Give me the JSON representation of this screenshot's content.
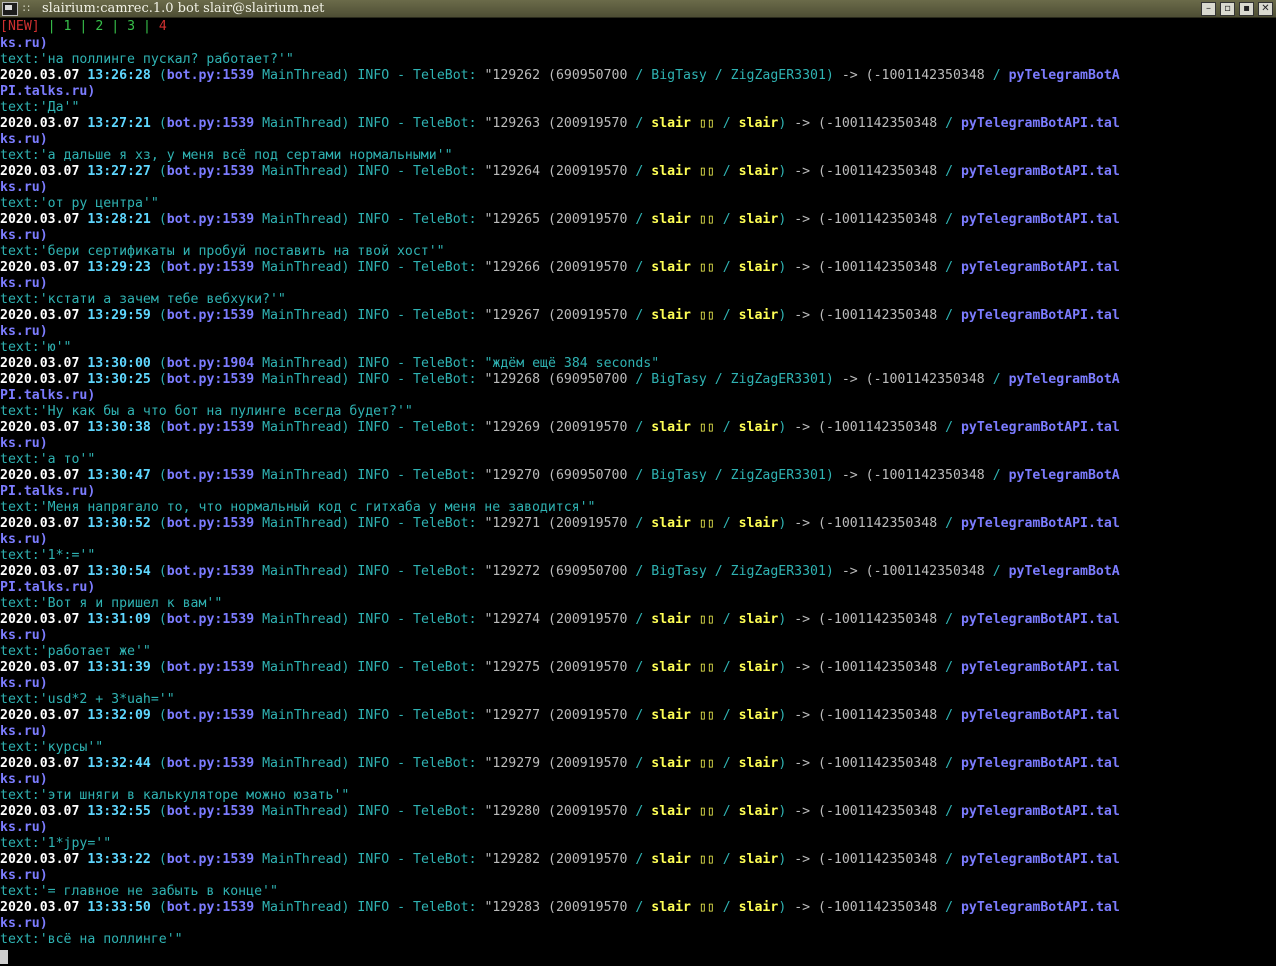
{
  "window": {
    "title": "slairium:camrec.1.0 bot slair@slairium.net",
    "controls": [
      "–",
      "▫",
      "▪",
      "✕"
    ]
  },
  "tabbar": {
    "new_label": "[NEW]",
    "tabs": [
      "1",
      "2",
      "3",
      "4"
    ],
    "active_tab": "4"
  },
  "log": {
    "lines": [
      {
        "kind": "wrap",
        "text": "ks.ru)"
      },
      {
        "kind": "text",
        "text": "text:'на поллинге пускал? работает?'\""
      },
      {
        "kind": "entry",
        "date": "2020.03.07",
        "time": "13:26:28",
        "file": "bot.py:1539",
        "thread": "MainThread",
        "level": "INFO",
        "logger": "TeleBot:",
        "id": "\"129262",
        "uid": "(690950700",
        "name1": "BigTasy",
        "name2": "ZigZagER3301)",
        "chat_id": "-> (-1001142350348",
        "chat": "pyTelegramBotA",
        "style": "plain"
      },
      {
        "kind": "wrap",
        "text": "PI.talks.ru)"
      },
      {
        "kind": "text",
        "text": "text:'Да'\""
      },
      {
        "kind": "entry",
        "date": "2020.03.07",
        "time": "13:27:21",
        "file": "bot.py:1539",
        "thread": "MainThread",
        "level": "INFO",
        "logger": "TeleBot:",
        "id": "\"129263",
        "uid": "(200919570",
        "name1": "slair ▯▯",
        "name2": "slair)",
        "chat_id": "-> (-1001142350348",
        "chat": "pyTelegramBotAPI.tal",
        "style": "bold"
      },
      {
        "kind": "wrap",
        "text": "ks.ru)"
      },
      {
        "kind": "text",
        "text": "text:'а дальше я хз, у меня всё под сертами нормальными'\""
      },
      {
        "kind": "entry",
        "date": "2020.03.07",
        "time": "13:27:27",
        "file": "bot.py:1539",
        "thread": "MainThread",
        "level": "INFO",
        "logger": "TeleBot:",
        "id": "\"129264",
        "uid": "(200919570",
        "name1": "slair ▯▯",
        "name2": "slair)",
        "chat_id": "-> (-1001142350348",
        "chat": "pyTelegramBotAPI.tal",
        "style": "bold"
      },
      {
        "kind": "wrap",
        "text": "ks.ru)"
      },
      {
        "kind": "text",
        "text": "text:'от ру центра'\""
      },
      {
        "kind": "entry",
        "date": "2020.03.07",
        "time": "13:28:21",
        "file": "bot.py:1539",
        "thread": "MainThread",
        "level": "INFO",
        "logger": "TeleBot:",
        "id": "\"129265",
        "uid": "(200919570",
        "name1": "slair ▯▯",
        "name2": "slair)",
        "chat_id": "-> (-1001142350348",
        "chat": "pyTelegramBotAPI.tal",
        "style": "bold"
      },
      {
        "kind": "wrap",
        "text": "ks.ru)"
      },
      {
        "kind": "text",
        "text": "text:'бери сертификаты и пробуй поставить на твой хост'\""
      },
      {
        "kind": "entry",
        "date": "2020.03.07",
        "time": "13:29:23",
        "file": "bot.py:1539",
        "thread": "MainThread",
        "level": "INFO",
        "logger": "TeleBot:",
        "id": "\"129266",
        "uid": "(200919570",
        "name1": "slair ▯▯",
        "name2": "slair)",
        "chat_id": "-> (-1001142350348",
        "chat": "pyTelegramBotAPI.tal",
        "style": "bold"
      },
      {
        "kind": "wrap",
        "text": "ks.ru)"
      },
      {
        "kind": "text",
        "text": "text:'кстати а зачем тебе вебхуки?'\""
      },
      {
        "kind": "entry",
        "date": "2020.03.07",
        "time": "13:29:59",
        "file": "bot.py:1539",
        "thread": "MainThread",
        "level": "INFO",
        "logger": "TeleBot:",
        "id": "\"129267",
        "uid": "(200919570",
        "name1": "slair ▯▯",
        "name2": "slair)",
        "chat_id": "-> (-1001142350348",
        "chat": "pyTelegramBotAPI.tal",
        "style": "bold"
      },
      {
        "kind": "wrap",
        "text": "ks.ru)"
      },
      {
        "kind": "text",
        "text": "text:'ю'\""
      },
      {
        "kind": "wait",
        "date": "2020.03.07",
        "time": "13:30:00",
        "file": "bot.py:1904",
        "thread": "MainThread",
        "level": "INFO",
        "logger": "TeleBot:",
        "message": "\"ждём ещё 384 seconds\""
      },
      {
        "kind": "entry",
        "date": "2020.03.07",
        "time": "13:30:25",
        "file": "bot.py:1539",
        "thread": "MainThread",
        "level": "INFO",
        "logger": "TeleBot:",
        "id": "\"129268",
        "uid": "(690950700",
        "name1": "BigTasy",
        "name2": "ZigZagER3301)",
        "chat_id": "-> (-1001142350348",
        "chat": "pyTelegramBotA",
        "style": "plain"
      },
      {
        "kind": "wrap",
        "text": "PI.talks.ru)"
      },
      {
        "kind": "text",
        "text": "text:'Ну как бы а что бот на пулинге всегда будет?'\""
      },
      {
        "kind": "entry",
        "date": "2020.03.07",
        "time": "13:30:38",
        "file": "bot.py:1539",
        "thread": "MainThread",
        "level": "INFO",
        "logger": "TeleBot:",
        "id": "\"129269",
        "uid": "(200919570",
        "name1": "slair ▯▯",
        "name2": "slair)",
        "chat_id": "-> (-1001142350348",
        "chat": "pyTelegramBotAPI.tal",
        "style": "bold"
      },
      {
        "kind": "wrap",
        "text": "ks.ru)"
      },
      {
        "kind": "text",
        "text": "text:'а то'\""
      },
      {
        "kind": "entry",
        "date": "2020.03.07",
        "time": "13:30:47",
        "file": "bot.py:1539",
        "thread": "MainThread",
        "level": "INFO",
        "logger": "TeleBot:",
        "id": "\"129270",
        "uid": "(690950700",
        "name1": "BigTasy",
        "name2": "ZigZagER3301)",
        "chat_id": "-> (-1001142350348",
        "chat": "pyTelegramBotA",
        "style": "plain"
      },
      {
        "kind": "wrap",
        "text": "PI.talks.ru)"
      },
      {
        "kind": "text",
        "text": "text:'Меня напрягало то, что нормальный код с гитхаба у меня не заводится'\""
      },
      {
        "kind": "entry",
        "date": "2020.03.07",
        "time": "13:30:52",
        "file": "bot.py:1539",
        "thread": "MainThread",
        "level": "INFO",
        "logger": "TeleBot:",
        "id": "\"129271",
        "uid": "(200919570",
        "name1": "slair ▯▯",
        "name2": "slair)",
        "chat_id": "-> (-1001142350348",
        "chat": "pyTelegramBotAPI.tal",
        "style": "bold"
      },
      {
        "kind": "wrap",
        "text": "ks.ru)"
      },
      {
        "kind": "text",
        "text": "text:'1*:='\""
      },
      {
        "kind": "entry",
        "date": "2020.03.07",
        "time": "13:30:54",
        "file": "bot.py:1539",
        "thread": "MainThread",
        "level": "INFO",
        "logger": "TeleBot:",
        "id": "\"129272",
        "uid": "(690950700",
        "name1": "BigTasy",
        "name2": "ZigZagER3301)",
        "chat_id": "-> (-1001142350348",
        "chat": "pyTelegramBotA",
        "style": "plain"
      },
      {
        "kind": "wrap",
        "text": "PI.talks.ru)"
      },
      {
        "kind": "text",
        "text": "text:'Вот я и пришел к вам'\""
      },
      {
        "kind": "entry",
        "date": "2020.03.07",
        "time": "13:31:09",
        "file": "bot.py:1539",
        "thread": "MainThread",
        "level": "INFO",
        "logger": "TeleBot:",
        "id": "\"129274",
        "uid": "(200919570",
        "name1": "slair ▯▯",
        "name2": "slair)",
        "chat_id": "-> (-1001142350348",
        "chat": "pyTelegramBotAPI.tal",
        "style": "bold"
      },
      {
        "kind": "wrap",
        "text": "ks.ru)"
      },
      {
        "kind": "text",
        "text": "text:'работает же'\""
      },
      {
        "kind": "entry",
        "date": "2020.03.07",
        "time": "13:31:39",
        "file": "bot.py:1539",
        "thread": "MainThread",
        "level": "INFO",
        "logger": "TeleBot:",
        "id": "\"129275",
        "uid": "(200919570",
        "name1": "slair ▯▯",
        "name2": "slair)",
        "chat_id": "-> (-1001142350348",
        "chat": "pyTelegramBotAPI.tal",
        "style": "bold"
      },
      {
        "kind": "wrap",
        "text": "ks.ru)"
      },
      {
        "kind": "text",
        "text": "text:'usd*2 + 3*uah='\""
      },
      {
        "kind": "entry",
        "date": "2020.03.07",
        "time": "13:32:09",
        "file": "bot.py:1539",
        "thread": "MainThread",
        "level": "INFO",
        "logger": "TeleBot:",
        "id": "\"129277",
        "uid": "(200919570",
        "name1": "slair ▯▯",
        "name2": "slair)",
        "chat_id": "-> (-1001142350348",
        "chat": "pyTelegramBotAPI.tal",
        "style": "bold"
      },
      {
        "kind": "wrap",
        "text": "ks.ru)"
      },
      {
        "kind": "text",
        "text": "text:'курсы'\""
      },
      {
        "kind": "entry",
        "date": "2020.03.07",
        "time": "13:32:44",
        "file": "bot.py:1539",
        "thread": "MainThread",
        "level": "INFO",
        "logger": "TeleBot:",
        "id": "\"129279",
        "uid": "(200919570",
        "name1": "slair ▯▯",
        "name2": "slair)",
        "chat_id": "-> (-1001142350348",
        "chat": "pyTelegramBotAPI.tal",
        "style": "bold"
      },
      {
        "kind": "wrap",
        "text": "ks.ru)"
      },
      {
        "kind": "text",
        "text": "text:'эти шняги в калькуляторе можно юзать'\""
      },
      {
        "kind": "entry",
        "date": "2020.03.07",
        "time": "13:32:55",
        "file": "bot.py:1539",
        "thread": "MainThread",
        "level": "INFO",
        "logger": "TeleBot:",
        "id": "\"129280",
        "uid": "(200919570",
        "name1": "slair ▯▯",
        "name2": "slair)",
        "chat_id": "-> (-1001142350348",
        "chat": "pyTelegramBotAPI.tal",
        "style": "bold"
      },
      {
        "kind": "wrap",
        "text": "ks.ru)"
      },
      {
        "kind": "text",
        "text": "text:'1*jpy='\""
      },
      {
        "kind": "entry",
        "date": "2020.03.07",
        "time": "13:33:22",
        "file": "bot.py:1539",
        "thread": "MainThread",
        "level": "INFO",
        "logger": "TeleBot:",
        "id": "\"129282",
        "uid": "(200919570",
        "name1": "slair ▯▯",
        "name2": "slair)",
        "chat_id": "-> (-1001142350348",
        "chat": "pyTelegramBotAPI.tal",
        "style": "bold"
      },
      {
        "kind": "wrap",
        "text": "ks.ru)"
      },
      {
        "kind": "text",
        "text": "text:'= главное не забыть в конце'\""
      },
      {
        "kind": "entry",
        "date": "2020.03.07",
        "time": "13:33:50",
        "file": "bot.py:1539",
        "thread": "MainThread",
        "level": "INFO",
        "logger": "TeleBot:",
        "id": "\"129283",
        "uid": "(200919570",
        "name1": "slair ▯▯",
        "name2": "slair)",
        "chat_id": "-> (-1001142350348",
        "chat": "pyTelegramBotAPI.tal",
        "style": "bold"
      },
      {
        "kind": "wrap",
        "text": "ks.ru)"
      },
      {
        "kind": "text",
        "text": "text:'всё на поллинге'\""
      }
    ]
  },
  "colors": {
    "background": "#000000",
    "default_text": "#2fb3b3",
    "date": "#ffffff",
    "time": "#5fd7ff",
    "file": "#7c7cff",
    "user_bold": "#ffff55",
    "chat": "#7c7cff",
    "tab_red": "#d03030",
    "tab_green": "#37c04a"
  }
}
